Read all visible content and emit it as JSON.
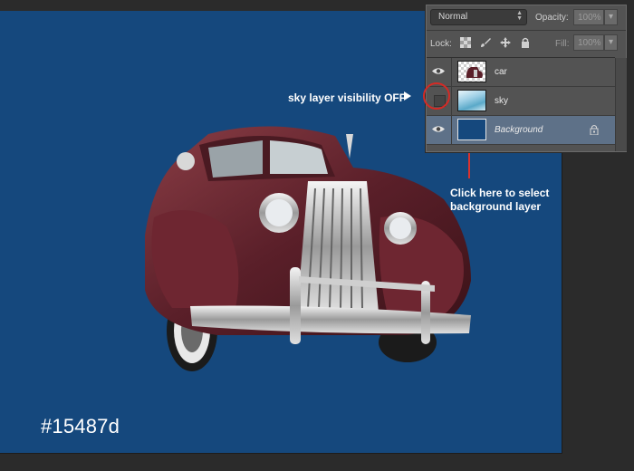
{
  "canvas": {
    "background_color": "#15487d",
    "hex_label": "#15487d"
  },
  "annotations": {
    "sky_visibility": "sky layer visibility OFF",
    "background_select_line1": "Click here to select",
    "background_select_line2": "background layer",
    "highlight_color": "#d42a25"
  },
  "layers_panel": {
    "blend_mode": "Normal",
    "opacity_label": "Opacity:",
    "opacity_value": "100%",
    "lock_label": "Lock:",
    "fill_label": "Fill:",
    "fill_value": "100%",
    "lock_icons": [
      "checkerboard-icon",
      "brush-icon",
      "move-icon",
      "lock-icon"
    ],
    "layers": [
      {
        "name": "car",
        "visible": true,
        "thumbnail": "car"
      },
      {
        "name": "sky",
        "visible": false,
        "thumbnail": "sky"
      },
      {
        "name": "Background",
        "visible": true,
        "thumbnail": "solid-color",
        "selected": true,
        "locked": true
      }
    ]
  }
}
